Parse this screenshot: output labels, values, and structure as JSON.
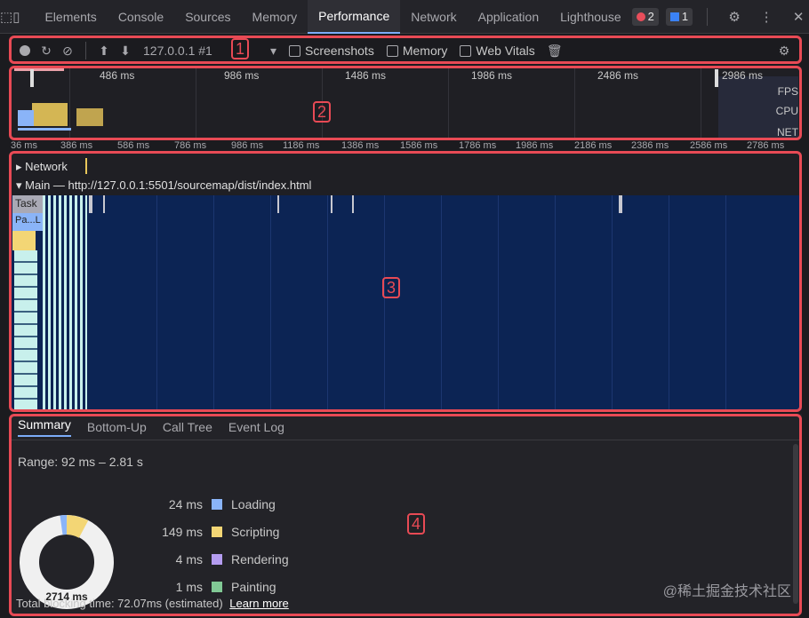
{
  "tabbar": {
    "tabs": [
      "Elements",
      "Console",
      "Sources",
      "Memory",
      "Performance",
      "Network",
      "Application",
      "Lighthouse"
    ],
    "active_tab": "Performance",
    "error_count": "2",
    "message_count": "1"
  },
  "toolbar": {
    "target": "127.0.0.1 #1",
    "checkboxes": [
      "Screenshots",
      "Memory",
      "Web Vitals"
    ]
  },
  "regions": {
    "r1": "1",
    "r2": "2",
    "r3": "3",
    "r4": "4"
  },
  "overview": {
    "ticks": [
      "486 ms",
      "986 ms",
      "1486 ms",
      "1986 ms",
      "2486 ms",
      "2986 ms"
    ],
    "labels": [
      "FPS",
      "CPU",
      "NET"
    ]
  },
  "ruler": [
    "36 ms",
    "386 ms",
    "586 ms",
    "786 ms",
    "986 ms",
    "1186 ms",
    "1386 ms",
    "1586 ms",
    "1786 ms",
    "1986 ms",
    "2186 ms",
    "2386 ms",
    "2586 ms",
    "2786 ms"
  ],
  "flame": {
    "network_label": "Network",
    "main_label": "Main — http://127.0.0.1:5501/sourcemap/dist/index.html",
    "task_label": "Task",
    "parse_label": "Pa...L"
  },
  "bottom": {
    "tabs": [
      "Summary",
      "Bottom-Up",
      "Call Tree",
      "Event Log"
    ],
    "active_tab": "Summary",
    "range": "Range: 92 ms – 2.81 s",
    "legend": [
      {
        "value": "24 ms",
        "label": "Loading",
        "color": "#8ab4f8"
      },
      {
        "value": "149 ms",
        "label": "Scripting",
        "color": "#f3d675"
      },
      {
        "value": "4 ms",
        "label": "Rendering",
        "color": "#b49cf0"
      },
      {
        "value": "1 ms",
        "label": "Painting",
        "color": "#81c995"
      }
    ],
    "total": "2714 ms",
    "footer": "Total blocking time: 72.07ms (estimated)",
    "footer_link": "Learn more"
  },
  "watermark": "@稀土掘金技术社区"
}
